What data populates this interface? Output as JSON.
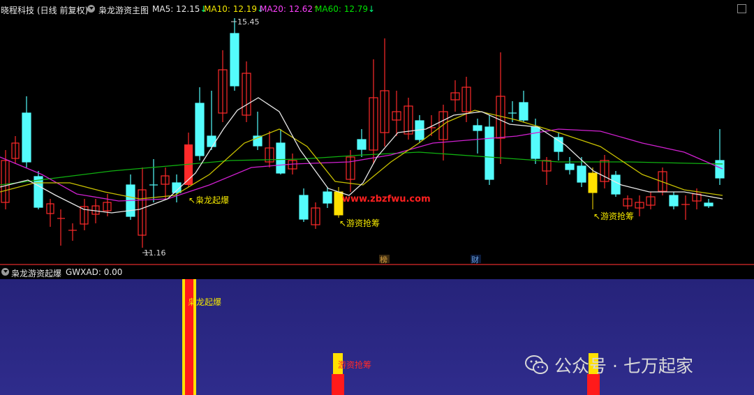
{
  "header": {
    "stock": "晓程科技",
    "period": "(日线 前复权)",
    "indicator_name": "枭龙游资主图",
    "ma": [
      {
        "label": "MA5: 12.15",
        "arrow": "↓",
        "color": "#e8e8e8"
      },
      {
        "label": "MA10: 12.19",
        "arrow": "↓",
        "color": "#f2e600"
      },
      {
        "label": "MA20: 12.62",
        "arrow": "↑",
        "color": "#ff40ff"
      },
      {
        "label": "MA60: 12.79",
        "arrow": "↓",
        "color": "#00e000"
      }
    ]
  },
  "main_chart": {
    "price_high_label": "15.45",
    "price_low_label": "11.16",
    "website": "www.zbzfwu.com",
    "signal_labels": [
      {
        "text": "↖枭龙起爆"
      },
      {
        "text": "↖游资抢筹"
      },
      {
        "text": "↖游资抢筹"
      }
    ],
    "event_markers": [
      "榜",
      "财"
    ]
  },
  "sub_panel": {
    "title": "枭龙游资起爆",
    "value": "GWXAD: 0.00",
    "labels": [
      "枭龙起爆",
      "游资抢筹"
    ]
  },
  "watermark": {
    "text": "公众号 · 七万起家"
  },
  "colors": {
    "up": "#ff2a2a",
    "down": "#54fcfc",
    "signal": "#ffe000",
    "ma5": "#e8e8e8",
    "ma10": "#c8c000",
    "ma20": "#d020d0",
    "ma60": "#10b010"
  }
}
